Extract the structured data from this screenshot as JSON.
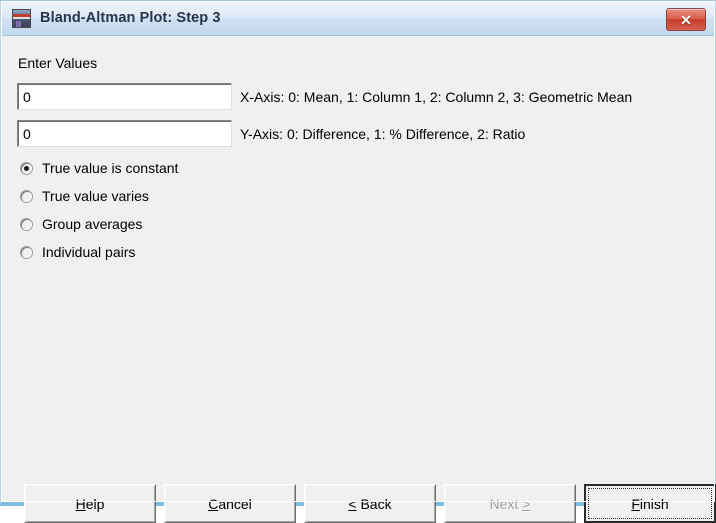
{
  "window": {
    "title": "Bland-Altman Plot: Step 3",
    "icon": "plot-window-icon",
    "close_glyph": "✕",
    "close_icon_name": "close-icon",
    "accent_close_color": "#c63c2b",
    "titlebar_color": "#cfe0f3",
    "client_color": "#f0f0f0"
  },
  "form": {
    "group_label": "Enter Values",
    "fields": [
      {
        "name": "x-axis",
        "value": "0",
        "placeholder": "",
        "hint": "X-Axis: 0: Mean, 1: Column 1, 2: Column 2, 3: Geometric Mean"
      },
      {
        "name": "y-axis",
        "value": "0",
        "placeholder": "",
        "hint": "Y-Axis: 0: Difference, 1: % Difference, 2: Ratio"
      }
    ],
    "radio_group": {
      "name": "true-value-mode",
      "options": [
        {
          "label": "True value is constant",
          "checked": true
        },
        {
          "label": "True value varies",
          "checked": false
        },
        {
          "label": "Group averages",
          "checked": false
        },
        {
          "label": "Individual pairs",
          "checked": false
        }
      ]
    }
  },
  "buttons": [
    {
      "name": "help",
      "label": "Help",
      "accel": "H",
      "pre": "",
      "post": "elp",
      "disabled": false,
      "default": false
    },
    {
      "name": "cancel",
      "label": "Cancel",
      "accel": "C",
      "pre": "",
      "post": "ancel",
      "disabled": false,
      "default": false
    },
    {
      "name": "back",
      "label": "< Back",
      "accel": "<",
      "pre": "",
      "post": " Back",
      "disabled": false,
      "default": false
    },
    {
      "name": "next",
      "label": "Next >",
      "accel": ">",
      "pre": "Next ",
      "post": "",
      "disabled": true,
      "default": false
    },
    {
      "name": "finish",
      "label": "Finish",
      "accel": "F",
      "pre": "",
      "post": "inish",
      "disabled": false,
      "default": true
    }
  ]
}
